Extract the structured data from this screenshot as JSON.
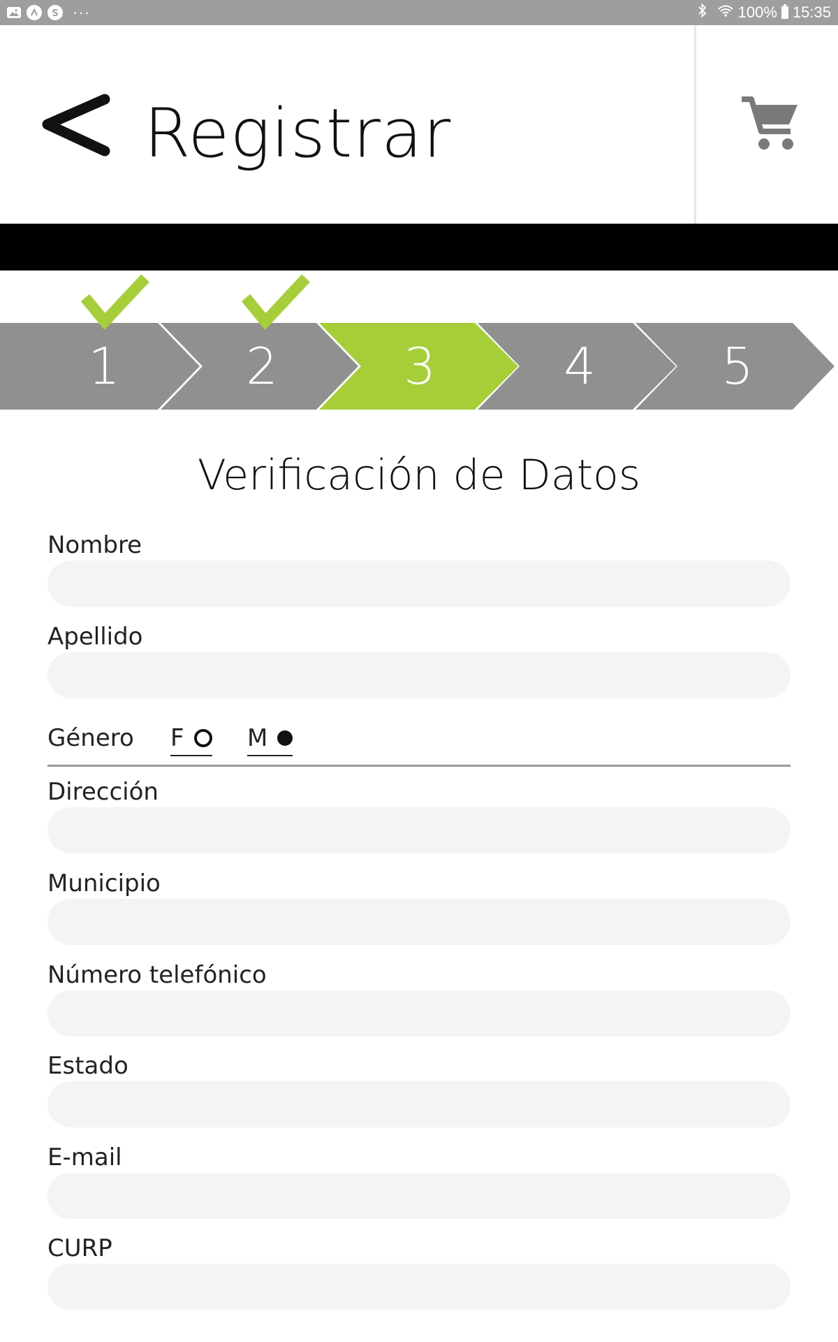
{
  "status_bar": {
    "icons_left": [
      "image-icon",
      "a-icon",
      "s-icon"
    ],
    "overflow": "···",
    "bluetooth_icon": "bluetooth-icon",
    "wifi_icon": "wifi-icon",
    "battery_percent": "100%",
    "time": "15:35"
  },
  "header": {
    "title": "Registrar",
    "back_icon": "chevron-left-icon",
    "cart_icon": "cart-icon"
  },
  "steps": {
    "items": [
      {
        "label": "1",
        "completed": true,
        "active": false
      },
      {
        "label": "2",
        "completed": true,
        "active": false
      },
      {
        "label": "3",
        "completed": false,
        "active": true
      },
      {
        "label": "4",
        "completed": false,
        "active": false
      },
      {
        "label": "5",
        "completed": false,
        "active": false
      }
    ],
    "colors": {
      "inactive": "#909090",
      "active": "#a6ce39",
      "check": "#a6ce39"
    }
  },
  "form": {
    "title": "Verificación de Datos",
    "fields": {
      "nombre": {
        "label": "Nombre",
        "value": ""
      },
      "apellido": {
        "label": "Apellido",
        "value": ""
      },
      "direccion": {
        "label": "Dirección",
        "value": ""
      },
      "municipio": {
        "label": "Municipio",
        "value": ""
      },
      "telefono": {
        "label": "Número telefónico",
        "value": ""
      },
      "estado": {
        "label": "Estado",
        "value": ""
      },
      "email": {
        "label": "E-mail",
        "value": ""
      },
      "curp": {
        "label": "CURP",
        "value": ""
      }
    },
    "gender": {
      "label": "Género",
      "options": [
        {
          "label": "F",
          "selected": false
        },
        {
          "label": "M",
          "selected": true
        }
      ]
    }
  }
}
